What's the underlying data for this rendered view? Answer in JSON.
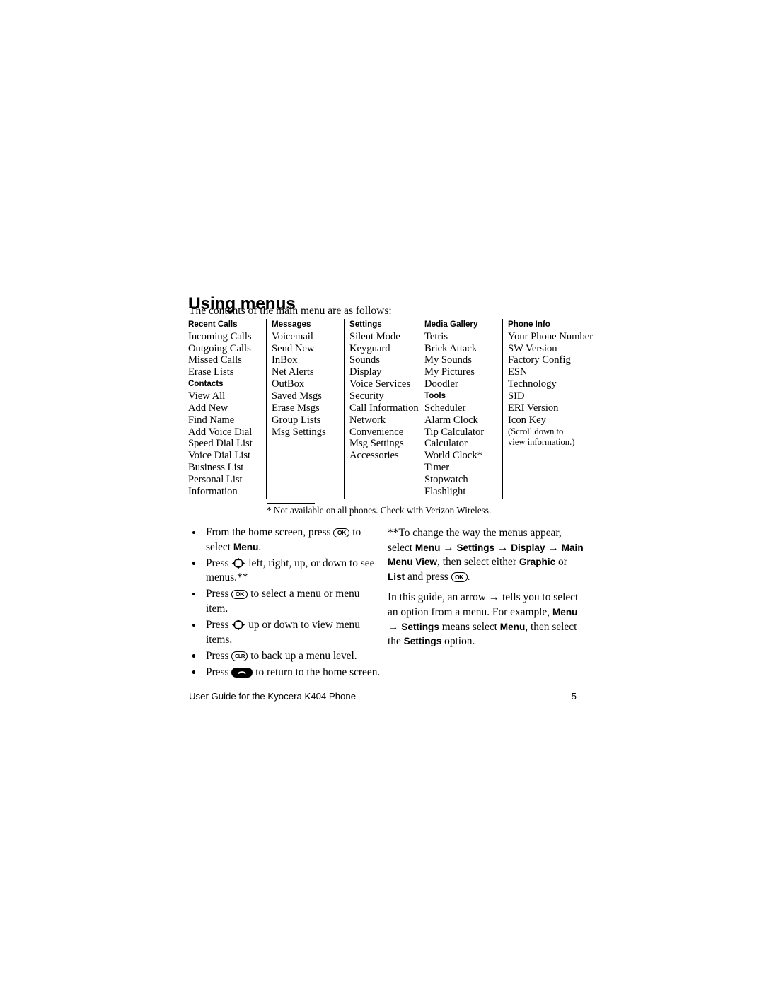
{
  "page": {
    "heading": "Using menus",
    "intro": "The contents of the main menu are as follows:",
    "footnote": "* Not available on all phones. Check with Verizon Wireless."
  },
  "menu_table": {
    "columns": [
      {
        "header": "Recent Calls",
        "items": [
          "Incoming Calls",
          "Outgoing Calls",
          "Missed Calls",
          "Erase Lists"
        ],
        "subheader": "Contacts",
        "subitems": [
          "View All",
          "Add New",
          "Find Name",
          "Add Voice Dial",
          "Speed Dial List",
          "Voice Dial List",
          "Business List",
          "Personal List",
          "Information"
        ]
      },
      {
        "header": "Messages",
        "items": [
          "Voicemail",
          "Send New",
          "InBox",
          "Net Alerts",
          "OutBox",
          "Saved Msgs",
          "Erase Msgs",
          "Group Lists",
          "Msg Settings"
        ],
        "subheader": "",
        "subitems": []
      },
      {
        "header": "Settings",
        "items": [
          "Silent Mode",
          "Keyguard",
          "Sounds",
          "Display",
          "Voice Services",
          "Security",
          "Call Information",
          "Network",
          "Convenience",
          "Msg Settings",
          "Accessories"
        ],
        "subheader": "",
        "subitems": []
      },
      {
        "header": "Media Gallery",
        "items": [
          "Tetris",
          "Brick Attack",
          "My Sounds",
          "My Pictures",
          "Doodler"
        ],
        "subheader": "Tools",
        "subitems": [
          "Scheduler",
          "Alarm Clock",
          "Tip Calculator",
          "Calculator",
          "World Clock*",
          "Timer",
          "Stopwatch",
          "Flashlight"
        ]
      },
      {
        "header": "Phone Info",
        "items": [
          "Your Phone Number",
          "SW Version",
          "Factory Config",
          "ESN",
          "Technology",
          "SID",
          "ERI Version",
          "Icon Key"
        ],
        "note": "(Scroll down to view information.)",
        "subheader": "",
        "subitems": []
      }
    ]
  },
  "bullets": [
    {
      "pre": "From the home screen, press ",
      "icon": "ok-key-icon",
      "mid": " to select ",
      "bold": "Menu",
      "post": "."
    },
    {
      "pre": "Press ",
      "icon": "navigation-pad-icon",
      "mid": " left, right, up, or down to see menus.**",
      "bold": "",
      "post": ""
    },
    {
      "pre": "Press ",
      "icon": "ok-key-icon",
      "mid": " to select a menu or menu item.",
      "bold": "",
      "post": ""
    },
    {
      "pre": "Press ",
      "icon": "navigation-pad-icon",
      "mid": " up or down to view menu items.",
      "bold": "",
      "post": ""
    },
    {
      "pre": "Press ",
      "icon": "clr-key-icon",
      "mid": " to back up a menu level.",
      "bold": "",
      "post": ""
    },
    {
      "pre": "Press ",
      "icon": "end-key-icon",
      "mid": " to return to the home screen.",
      "bold": "",
      "post": ""
    }
  ],
  "right_note": {
    "para1_pre": "**To change the way the menus appear, select ",
    "path": [
      "Menu",
      "Settings",
      "Display",
      "Main Menu View"
    ],
    "para1_mid": ", then select either ",
    "opt1": "Graphic",
    "para1_or": " or ",
    "opt2": "List",
    "para1_post": " and press ",
    "para1_icon": "ok-key-icon",
    "para1_end": ".",
    "para2_pre": "In this guide, an arrow ",
    "para2_arrow": "→",
    "para2_mid": " tells you to select an option from a menu. For example, ",
    "para2_menu": "Menu",
    "para2_arrow2": "→",
    "para2_settings": "Settings",
    "para2_mid2": " means select ",
    "para2_menu2": "Menu",
    "para2_mid3": ", then select the ",
    "para2_settings2": "Settings",
    "para2_post": " option."
  },
  "footer": {
    "text": "User Guide for the Kyocera K404 Phone",
    "page_number": "5"
  },
  "colors": {
    "text": "#000000",
    "footer_rule": "#808080",
    "background": "#ffffff"
  },
  "icon_labels": {
    "ok": "OK",
    "clr": "CLR"
  }
}
